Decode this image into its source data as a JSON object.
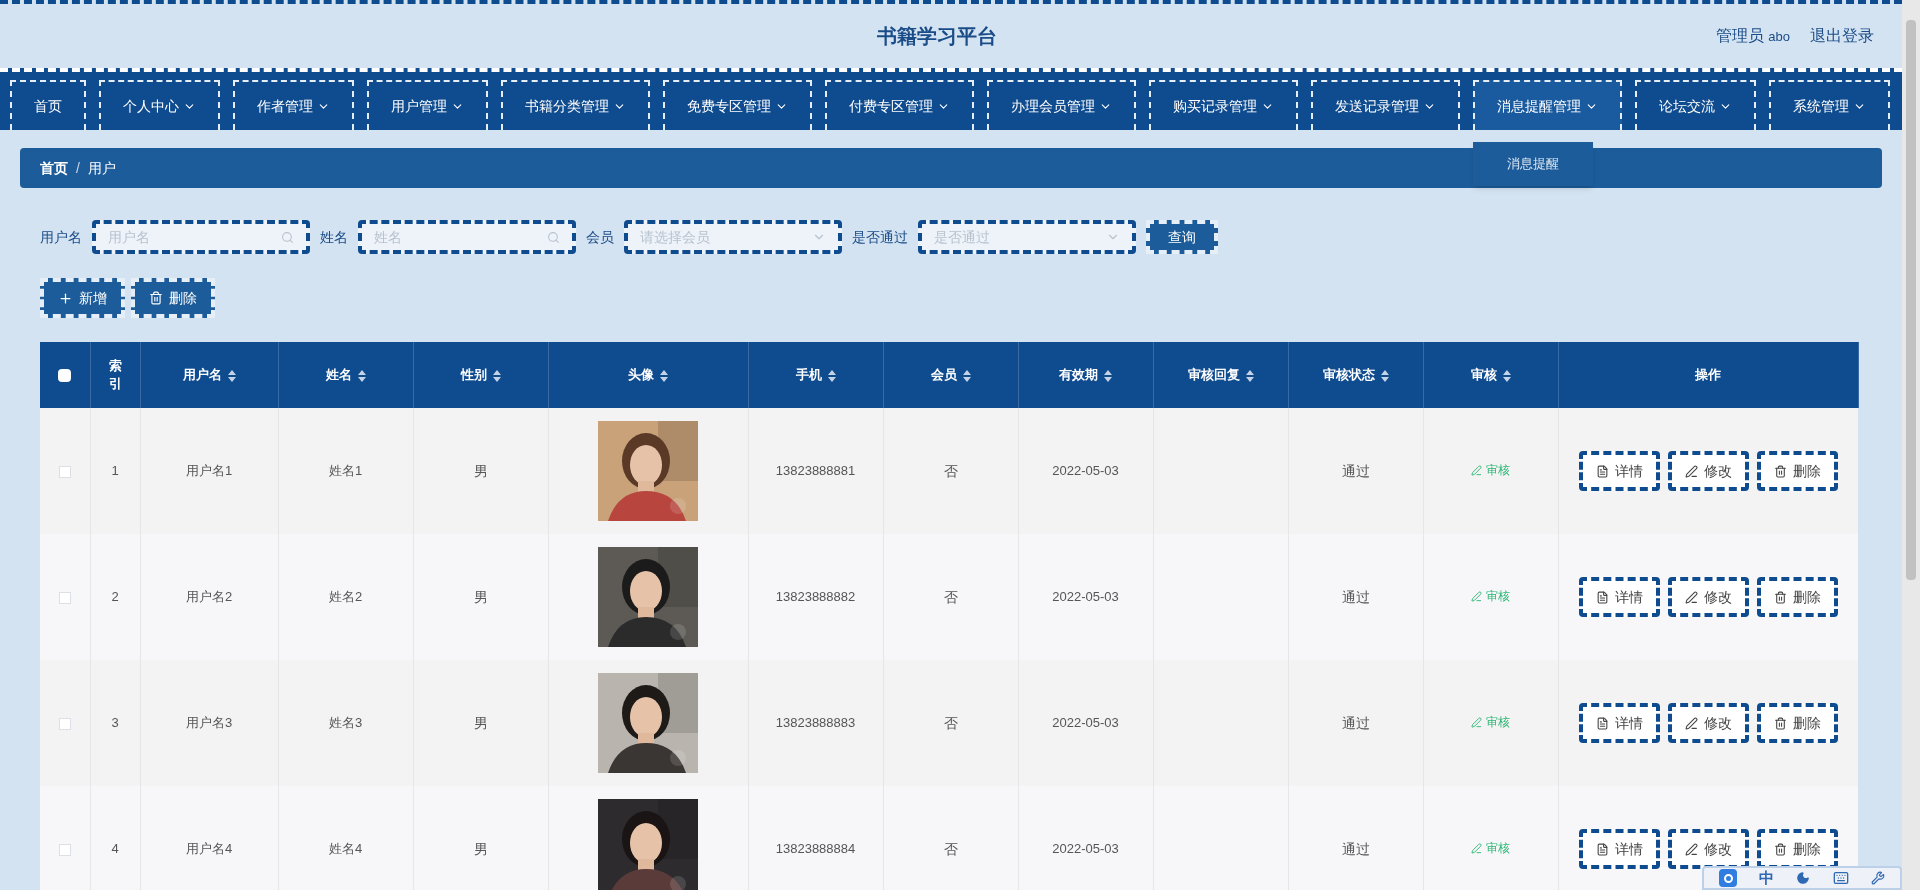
{
  "header": {
    "title": "书籍学习平台",
    "user_role": "管理员",
    "user_name": "abo",
    "logout": "退出登录"
  },
  "nav": [
    {
      "label": "首页",
      "dropdown": false,
      "expanded": false
    },
    {
      "label": "个人中心",
      "dropdown": true,
      "expanded": false
    },
    {
      "label": "作者管理",
      "dropdown": true,
      "expanded": false
    },
    {
      "label": "用户管理",
      "dropdown": true,
      "expanded": false
    },
    {
      "label": "书籍分类管理",
      "dropdown": true,
      "expanded": false
    },
    {
      "label": "免费专区管理",
      "dropdown": true,
      "expanded": false
    },
    {
      "label": "付费专区管理",
      "dropdown": true,
      "expanded": false
    },
    {
      "label": "办理会员管理",
      "dropdown": true,
      "expanded": false
    },
    {
      "label": "购买记录管理",
      "dropdown": true,
      "expanded": false
    },
    {
      "label": "发送记录管理",
      "dropdown": true,
      "expanded": false
    },
    {
      "label": "消息提醒管理",
      "dropdown": true,
      "expanded": true,
      "children": [
        "消息提醒"
      ]
    },
    {
      "label": "论坛交流",
      "dropdown": true,
      "expanded": false
    },
    {
      "label": "系统管理",
      "dropdown": true,
      "expanded": false
    }
  ],
  "breadcrumb": [
    "首页",
    "用户"
  ],
  "breadcrumb_separator": "/",
  "filters": [
    {
      "label": "用户名",
      "placeholder": "用户名",
      "kind": "text"
    },
    {
      "label": "姓名",
      "placeholder": "姓名",
      "kind": "text"
    },
    {
      "label": "会员",
      "placeholder": "请选择会员",
      "kind": "select"
    },
    {
      "label": "是否通过",
      "placeholder": "是否通过",
      "kind": "select"
    }
  ],
  "search_button": "查询",
  "actions": [
    {
      "label": "新增",
      "kind": "add"
    },
    {
      "label": "删除",
      "kind": "delete"
    }
  ],
  "table": {
    "select_all_checked": false,
    "columns": [
      {
        "label": "索引",
        "sortable": false
      },
      {
        "label": "用户名",
        "sortable": true
      },
      {
        "label": "姓名",
        "sortable": true
      },
      {
        "label": "性别",
        "sortable": true
      },
      {
        "label": "头像",
        "sortable": true
      },
      {
        "label": "手机",
        "sortable": true
      },
      {
        "label": "会员",
        "sortable": true
      },
      {
        "label": "有效期",
        "sortable": true
      },
      {
        "label": "审核回复",
        "sortable": true
      },
      {
        "label": "审核状态",
        "sortable": true
      },
      {
        "label": "审核",
        "sortable": true
      },
      {
        "label": "操作",
        "sortable": false
      }
    ],
    "rows": [
      {
        "checked": false,
        "index": "1",
        "username": "用户名1",
        "name": "姓名1",
        "gender": "男",
        "avatar": {
          "kind": "picture"
        },
        "phone": "13823888881",
        "member": "否",
        "expiry": "2022-05-03",
        "reply": "",
        "status": "通过",
        "review": "审核",
        "ops": [
          "详情",
          "修改",
          "删除"
        ]
      },
      {
        "checked": false,
        "index": "2",
        "username": "用户名2",
        "name": "姓名2",
        "gender": "男",
        "avatar": {
          "kind": "picture"
        },
        "phone": "13823888882",
        "member": "否",
        "expiry": "2022-05-03",
        "reply": "",
        "status": "通过",
        "review": "审核",
        "ops": [
          "详情",
          "修改",
          "删除"
        ]
      },
      {
        "checked": false,
        "index": "3",
        "username": "用户名3",
        "name": "姓名3",
        "gender": "男",
        "avatar": {
          "kind": "picture"
        },
        "phone": "13823888883",
        "member": "否",
        "expiry": "2022-05-03",
        "reply": "",
        "status": "通过",
        "review": "审核",
        "ops": [
          "详情",
          "修改",
          "删除"
        ]
      },
      {
        "checked": false,
        "index": "4",
        "username": "用户名4",
        "name": "姓名4",
        "gender": "男",
        "avatar": {
          "kind": "picture"
        },
        "phone": "13823888884",
        "member": "否",
        "expiry": "2022-05-03",
        "reply": "",
        "status": "通过",
        "review": "审核",
        "ops": [
          "详情",
          "修改",
          "删除"
        ]
      }
    ]
  },
  "ime_toolbar": {
    "mode": "中"
  }
}
